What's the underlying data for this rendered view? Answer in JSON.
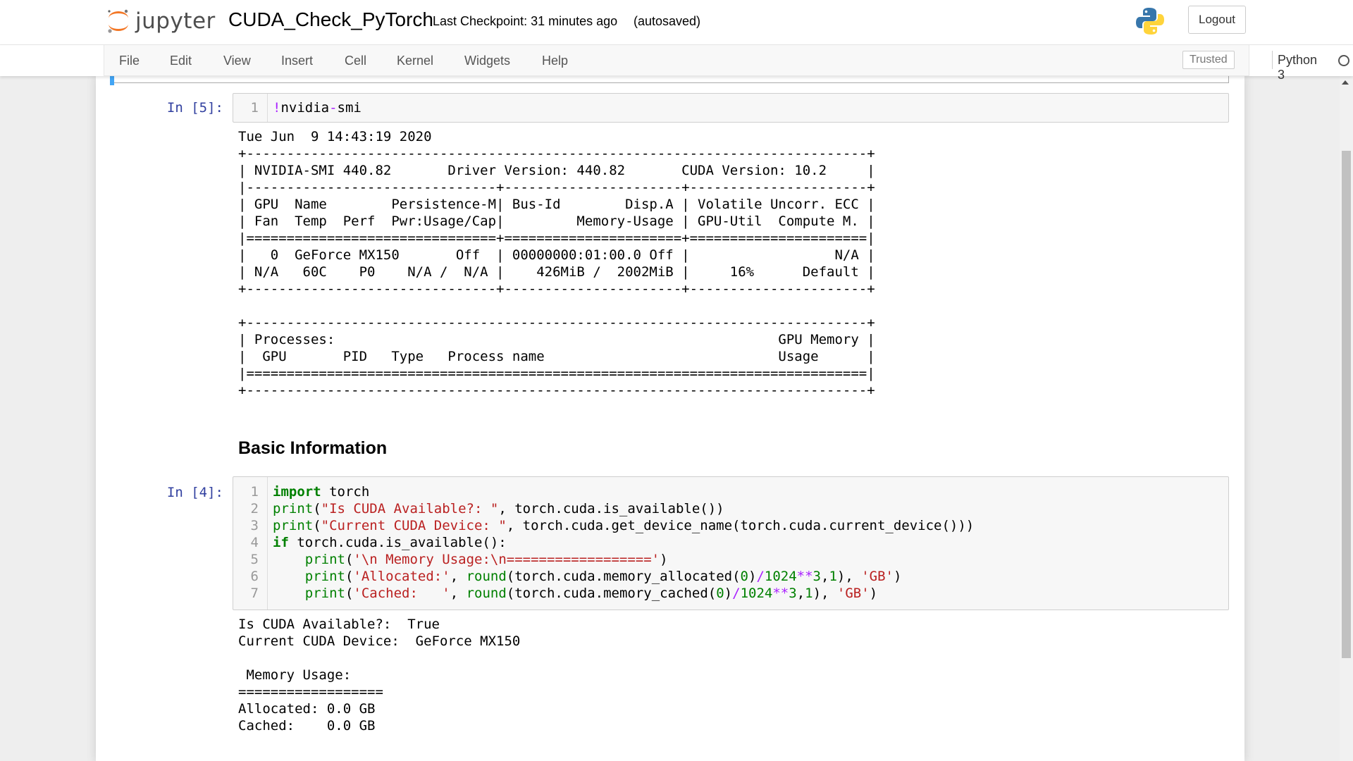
{
  "header": {
    "logo_text": "jupyter",
    "notebook_name": "CUDA_Check_PyTorch",
    "checkpoint": "Last Checkpoint: 31 minutes ago",
    "autosave": "(autosaved)",
    "logout_label": "Logout"
  },
  "menubar": {
    "items": [
      "File",
      "Edit",
      "View",
      "Insert",
      "Cell",
      "Kernel",
      "Widgets",
      "Help"
    ],
    "trusted_label": "Trusted",
    "kernel_name": "Python 3",
    "kernel_status": "idle"
  },
  "cells": {
    "smi": {
      "prompt": "In [5]:",
      "line_number": "1",
      "code": "!nvidia-smi",
      "output": "Tue Jun  9 14:43:19 2020       \n+-----------------------------------------------------------------------------+\n| NVIDIA-SMI 440.82       Driver Version: 440.82       CUDA Version: 10.2     |\n|-------------------------------+----------------------+----------------------+\n| GPU  Name        Persistence-M| Bus-Id        Disp.A | Volatile Uncorr. ECC |\n| Fan  Temp  Perf  Pwr:Usage/Cap|         Memory-Usage | GPU-Util  Compute M. |\n|===============================+======================+======================|\n|   0  GeForce MX150       Off  | 00000000:01:00.0 Off |                  N/A |\n| N/A   60C    P0    N/A /  N/A |    426MiB /  2002MiB |     16%      Default |\n+-------------------------------+----------------------+----------------------+\n                                                                               \n+-----------------------------------------------------------------------------+\n| Processes:                                                       GPU Memory |\n|  GPU       PID   Type   Process name                             Usage      |\n|=============================================================================|\n+-----------------------------------------------------------------------------+"
    },
    "heading": "Basic Information",
    "info": {
      "prompt": "In [4]:",
      "line_numbers": [
        "1",
        "2",
        "3",
        "4",
        "5",
        "6",
        "7"
      ],
      "code": [
        "import torch",
        "print(\"Is CUDA Available?: \", torch.cuda.is_available())",
        "print(\"Current CUDA Device: \", torch.cuda.get_device_name(torch.cuda.current_device()))",
        "if torch.cuda.is_available():",
        "    print('\\n Memory Usage:\\n==================')",
        "    print('Allocated:', round(torch.cuda.memory_allocated(0)/1024**3,1), 'GB')",
        "    print('Cached:   ', round(torch.cuda.memory_cached(0)/1024**3,1), 'GB')"
      ],
      "output": "Is CUDA Available?:  True\nCurrent CUDA Device:  GeForce MX150\n\n Memory Usage:\n==================\nAllocated: 0.0 GB\nCached:    0.0 GB"
    }
  },
  "colors": {
    "prompt": "#303f9f",
    "keyword": "#008000",
    "string": "#ba2121",
    "operator": "#aa22ff",
    "selected_cell_bar": "#42a5f5",
    "logo_orange": "#f37726"
  }
}
